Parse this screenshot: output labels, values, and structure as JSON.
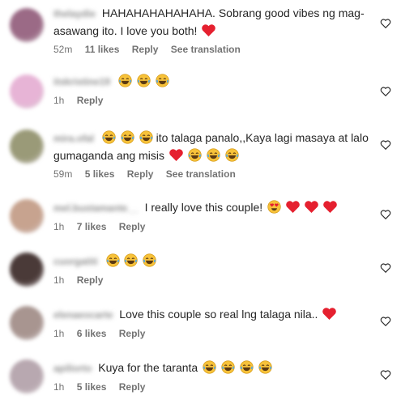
{
  "comments": [
    {
      "username": "thelaydie",
      "avatar_color": "#9b6a86",
      "text": "HAHAHAHAHAHAHA. Sobrang good vibes ng mag-asawang ito. I love you both!",
      "emoji_after": [
        "heart"
      ],
      "time": "52m",
      "likes": "11 likes",
      "reply": "Reply",
      "translation": "See translation"
    },
    {
      "username": "itskristine19",
      "avatar_color": "#e7b4d6",
      "text": "",
      "emoji_after": [
        "laugh",
        "laugh",
        "laugh"
      ],
      "time": "1h",
      "likes": "",
      "reply": "Reply",
      "translation": ""
    },
    {
      "username": "mira.ofal",
      "avatar_color": "#9a9a78",
      "text": "ito talaga panalo,,Kaya lagi masaya at lalo gumaganda ang misis",
      "emoji_before": [
        "laugh",
        "laugh",
        "laugh"
      ],
      "emoji_after": [
        "heart",
        "laugh",
        "laugh",
        "laugh"
      ],
      "time": "59m",
      "likes": "5 likes",
      "reply": "Reply",
      "translation": "See translation"
    },
    {
      "username": "mel.bustamante__",
      "avatar_color": "#c7a38f",
      "text": "I really love this couple!",
      "emoji_after": [
        "heartface",
        "heart",
        "heart",
        "heart"
      ],
      "time": "1h",
      "likes": "7 likes",
      "reply": "Reply",
      "translation": ""
    },
    {
      "username": "cuorgatiti",
      "avatar_color": "#4a3a38",
      "text": "",
      "emoji_after": [
        "laugh",
        "laugh",
        "laugh"
      ],
      "time": "1h",
      "likes": "",
      "reply": "Reply",
      "translation": ""
    },
    {
      "username": "elenaeocarte",
      "avatar_color": "#a89590",
      "text": "Love this couple so real lng talaga nila..",
      "emoji_after": [
        "heart"
      ],
      "time": "1h",
      "likes": "6 likes",
      "reply": "Reply",
      "translation": ""
    },
    {
      "username": "apiliorto",
      "avatar_color": "#b8a8b0",
      "text": "Kuya for the taranta",
      "emoji_after": [
        "laugh",
        "laugh",
        "laugh",
        "laugh"
      ],
      "time": "1h",
      "likes": "5 likes",
      "reply": "Reply",
      "translation": ""
    }
  ]
}
